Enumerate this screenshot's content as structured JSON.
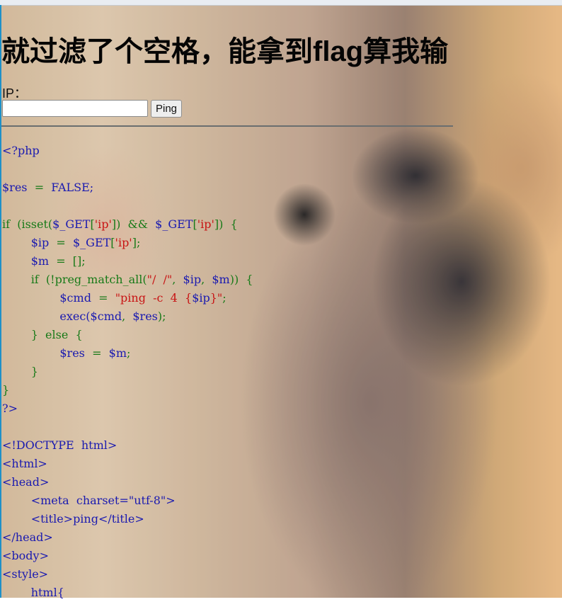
{
  "page": {
    "title": "就过滤了个空格，能拿到flag算我输"
  },
  "form": {
    "ip_label": "IP：",
    "ip_value": "",
    "ping_label": "Ping"
  },
  "code_lines": [
    [
      {
        "t": "<?php",
        "c": "p"
      }
    ],
    [],
    [
      {
        "t": "$res",
        "c": "v"
      },
      {
        "t": "  =  ",
        "c": "k"
      },
      {
        "t": "FALSE;",
        "c": "v"
      }
    ],
    [],
    [
      {
        "t": "if",
        "c": "k"
      },
      {
        "t": "  (isset(",
        "c": "k"
      },
      {
        "t": "$_GET",
        "c": "v"
      },
      {
        "t": "[",
        "c": "k"
      },
      {
        "t": "'ip'",
        "c": "s"
      },
      {
        "t": "])  &&  ",
        "c": "k"
      },
      {
        "t": "$_GET",
        "c": "v"
      },
      {
        "t": "[",
        "c": "k"
      },
      {
        "t": "'ip'",
        "c": "s"
      },
      {
        "t": "])  {",
        "c": "k"
      }
    ],
    [
      {
        "t": "        ",
        "c": "k"
      },
      {
        "t": "$ip",
        "c": "v"
      },
      {
        "t": "  =  ",
        "c": "k"
      },
      {
        "t": "$_GET",
        "c": "v"
      },
      {
        "t": "[",
        "c": "k"
      },
      {
        "t": "'ip'",
        "c": "s"
      },
      {
        "t": "];",
        "c": "k"
      }
    ],
    [
      {
        "t": "        ",
        "c": "k"
      },
      {
        "t": "$m",
        "c": "v"
      },
      {
        "t": "  =  [];",
        "c": "k"
      }
    ],
    [
      {
        "t": "        if  (!preg_match_all(",
        "c": "k"
      },
      {
        "t": "\"/  /\"",
        "c": "s"
      },
      {
        "t": ",  ",
        "c": "k"
      },
      {
        "t": "$ip",
        "c": "v"
      },
      {
        "t": ",  ",
        "c": "k"
      },
      {
        "t": "$m",
        "c": "v"
      },
      {
        "t": "))  {",
        "c": "k"
      }
    ],
    [
      {
        "t": "                ",
        "c": "k"
      },
      {
        "t": "$cmd",
        "c": "v"
      },
      {
        "t": "  =  ",
        "c": "k"
      },
      {
        "t": "\"ping  -c  4  {",
        "c": "s"
      },
      {
        "t": "$ip",
        "c": "v"
      },
      {
        "t": "}\"",
        "c": "s"
      },
      {
        "t": ";",
        "c": "k"
      }
    ],
    [
      {
        "t": "                exec(",
        "c": "v"
      },
      {
        "t": "$cmd",
        "c": "v"
      },
      {
        "t": ",  ",
        "c": "k"
      },
      {
        "t": "$res",
        "c": "v"
      },
      {
        "t": ");",
        "c": "k"
      }
    ],
    [
      {
        "t": "        }  else  {",
        "c": "k"
      }
    ],
    [
      {
        "t": "                ",
        "c": "k"
      },
      {
        "t": "$res",
        "c": "v"
      },
      {
        "t": "  =  ",
        "c": "k"
      },
      {
        "t": "$m",
        "c": "v"
      },
      {
        "t": ";",
        "c": "k"
      }
    ],
    [
      {
        "t": "        }",
        "c": "k"
      }
    ],
    [
      {
        "t": "}",
        "c": "k"
      }
    ],
    [
      {
        "t": "?>",
        "c": "p"
      }
    ],
    [],
    [
      {
        "t": "<!DOCTYPE  html>",
        "c": "t"
      }
    ],
    [
      {
        "t": "<html>",
        "c": "t"
      }
    ],
    [
      {
        "t": "<head>",
        "c": "t"
      }
    ],
    [
      {
        "t": "        <meta  charset=\"utf-8\">",
        "c": "t"
      }
    ],
    [
      {
        "t": "        <title>ping</title>",
        "c": "t"
      }
    ],
    [
      {
        "t": "</head>",
        "c": "t"
      }
    ],
    [
      {
        "t": "<body>",
        "c": "t"
      }
    ],
    [
      {
        "t": "<style>",
        "c": "t"
      }
    ],
    [
      {
        "t": "        html{",
        "c": "t"
      }
    ]
  ]
}
